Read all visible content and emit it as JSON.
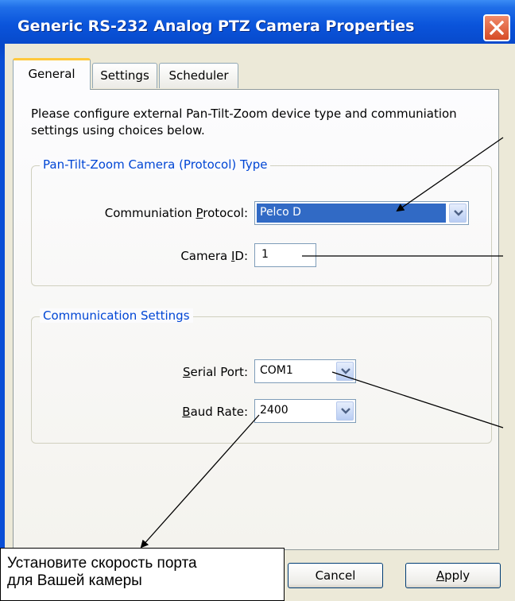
{
  "window": {
    "title": "Generic RS-232 Analog PTZ Camera Properties"
  },
  "tabs": [
    {
      "label": "General",
      "active": true
    },
    {
      "label": "Settings",
      "active": false
    },
    {
      "label": "Scheduler",
      "active": false
    }
  ],
  "intro": "Please configure external Pan-Tilt-Zoom device type and communiation settings using choices below.",
  "ptz_group": {
    "title": "Pan-Tilt-Zoom Camera  (Protocol) Type",
    "protocol_label_pre": "Communiation ",
    "protocol_label_access": "P",
    "protocol_label_post": "rotocol:",
    "protocol_value": "Pelco D",
    "camera_id_label_pre": "Camera ",
    "camera_id_label_access": "I",
    "camera_id_label_post": "D:",
    "camera_id_value": "1"
  },
  "comm_group": {
    "title": "Communication Settings",
    "serial_label_access": "S",
    "serial_label_post": "erial Port:",
    "serial_value": "COM1",
    "baud_label_access": "B",
    "baud_label_post": "aud Rate:",
    "baud_value": "2400"
  },
  "buttons": {
    "cancel": "Cancel",
    "apply_access": "A",
    "apply_post": "pply"
  },
  "callout": {
    "line1": "Установите скорость порта",
    "line2": "для Вашей камеры"
  },
  "icons": {
    "close": "close-icon",
    "dropdown": "chevron-down-icon"
  },
  "colors": {
    "title_bar": "#0a4fd6",
    "group_title": "#0046d5",
    "selection": "#316ac5",
    "close_button": "#d64b26"
  }
}
